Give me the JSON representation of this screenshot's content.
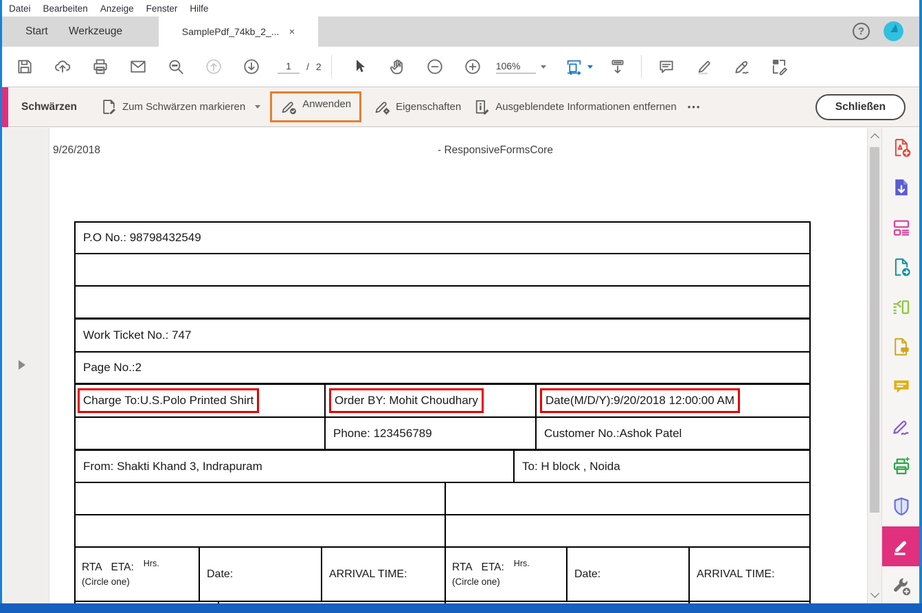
{
  "window": {
    "edge_color": "#1583d6",
    "bottom_bar_color": "#1660c0"
  },
  "menu_bar": {
    "items": [
      "Datei",
      "Bearbeiten",
      "Anzeige",
      "Fenster",
      "Hilfe"
    ]
  },
  "tab_bar": {
    "start_tab": "Start",
    "tools_tab": "Werkzeuge",
    "document_tab": "SamplePdf_74kb_2_...",
    "close_glyph": "×",
    "help_glyph": "?",
    "avatar_color": "#2fc1e0"
  },
  "toolbar": {
    "page_current": "1",
    "page_divider": "/",
    "page_total": "2",
    "zoom_value": "106%",
    "icons": [
      "save-icon",
      "share-cloud-icon",
      "print-icon",
      "email-icon",
      "search-icon",
      "previous-page-icon",
      "next-page-icon",
      "select-cursor-icon",
      "hand-tool-icon",
      "zoom-out-icon",
      "zoom-in-icon",
      "fit-width-icon",
      "page-scroll-icon",
      "comment-icon",
      "highlight-icon",
      "sign-icon",
      "fill-sign-icon"
    ]
  },
  "redact_toolbar": {
    "title": "Schwärzen",
    "mark_label": "Zum Schwärzen markieren",
    "apply_label": "Anwenden",
    "properties_label": "Eigenschaften",
    "remove_hidden_label": "Ausgeblendete Informationen entfernen",
    "more_label": "•••",
    "close_label": "Schließen",
    "accent_color": "#e0307e",
    "highlight_box_color": "#e87e2e"
  },
  "page": {
    "header_date": "9/26/2018",
    "header_title": "- ResponsiveFormsCore",
    "table": {
      "po_no": "P.O No.: 98798432549",
      "work_ticket": "Work Ticket No.: 747",
      "page_no": "Page No.:2",
      "charge_to": "Charge To:U.S.Polo Printed Shirt",
      "order_by": "Order BY: Mohit Choudhary",
      "date_mdy": "Date(M/D/Y):9/20/2018 12:00:00 AM",
      "phone": "Phone: 123456789",
      "customer_no": "Customer No.:Ashok Patel",
      "from": "From: Shakti Khand 3, Indrapuram",
      "to": "To: H block , Noida",
      "rta_eta": "RTA   ETA:",
      "hrs": "Hrs.",
      "circle_one": "(Circle one)",
      "date_label": "Date:",
      "arrival_label": "ARRIVAL TIME:",
      "redaction_mark_color": "#e60000"
    }
  },
  "right_rail": {
    "tools": [
      {
        "name": "create-pdf-icon",
        "color": "#de4b3b"
      },
      {
        "name": "export-pdf-icon",
        "color": "#5a5bd7"
      },
      {
        "name": "edit-pdf-icon",
        "color": "#d6459c"
      },
      {
        "name": "convert-pdf-icon",
        "color": "#12919f"
      },
      {
        "name": "organize-pages-icon",
        "color": "#8cc63f"
      },
      {
        "name": "request-comments-icon",
        "color": "#d1a51b"
      },
      {
        "name": "comment-icon",
        "color": "#ddb016"
      },
      {
        "name": "fill-sign-icon",
        "color": "#8b57d6"
      },
      {
        "name": "scan-ocr-icon",
        "color": "#2ba84a"
      },
      {
        "name": "protect-icon",
        "color": "#6672de"
      },
      {
        "name": "redact-icon",
        "color": "#e0307e",
        "active": true
      },
      {
        "name": "more-tools-icon",
        "color": "#707070"
      }
    ]
  },
  "scrollbar": {
    "thumb_color": "#c6c6c6"
  }
}
